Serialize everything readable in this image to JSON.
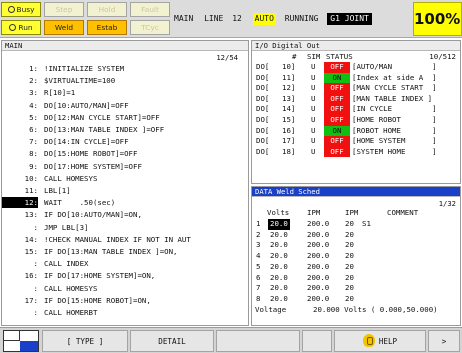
{
  "status_buttons": {
    "busy": "Busy",
    "step": "Step",
    "hold": "Hold",
    "fault": "Fault",
    "run": "Run",
    "weld": "Weld",
    "estab": "Estab",
    "tcyc": "TCyc"
  },
  "program_status": {
    "program": "MAIN",
    "line_label": "LINE",
    "line_number": "12",
    "mode": "AUTO",
    "state": "RUNNING",
    "group_joint": "G1  JOINT",
    "override": "100%"
  },
  "program_panel": {
    "title": "MAIN",
    "position": "12/54",
    "current_line": "12",
    "lines": [
      {
        "num": "1:",
        "text": "!INITIALIZE SYSTEM"
      },
      {
        "num": "2:",
        "text": "$VIRTUALTIME=100"
      },
      {
        "num": "3:",
        "text": "R[10]=1"
      },
      {
        "num": "4:",
        "text": "DO[10:AUTO/MAN]=OFF"
      },
      {
        "num": "5:",
        "text": "DO[12:MAN CYCLE START]=OFF"
      },
      {
        "num": "6:",
        "text": "DO[13:MAN TABLE INDEX ]=OFF"
      },
      {
        "num": "7:",
        "text": "DO[14:IN CYCLE]=OFF"
      },
      {
        "num": "8:",
        "text": "DO[15:HOME ROBOT]=OFF"
      },
      {
        "num": "9:",
        "text": "DO[17:HOME SYSTEM]=OFF"
      },
      {
        "num": "10:",
        "text": "CALL HOMESYS"
      },
      {
        "num": "11:",
        "text": "LBL[1]"
      },
      {
        "num": "12:",
        "text": "WAIT    .50(sec)"
      },
      {
        "num": "13:",
        "text": "IF DO[10:AUTO/MAN]=ON,"
      },
      {
        "num": ":",
        "text": "JMP LBL[3]"
      },
      {
        "num": "14:",
        "text": "!CHECK MANUAL INDEX IF NOT IN AUT"
      },
      {
        "num": "15:",
        "text": "IF DO[13:MAN TABLE INDEX ]=ON,"
      },
      {
        "num": ":",
        "text": "CALL INDEX"
      },
      {
        "num": "16:",
        "text": "IF DO[17:HOME SYSTEM]=ON,"
      },
      {
        "num": ":",
        "text": "CALL HOMESYS"
      },
      {
        "num": "17:",
        "text": "IF DO[15:HOME ROBOT]=ON,"
      },
      {
        "num": ":",
        "text": "CALL HOMERBT"
      }
    ]
  },
  "io_panel": {
    "title": "I/O Digital Out",
    "header_num": "#",
    "header_sim": "SIM",
    "header_status": "STATUS",
    "position": "10/512",
    "rows": [
      {
        "type": "DO[",
        "num": "10]",
        "sim": "U",
        "status": "OFF",
        "comment": "[AUTO/MAN         ]"
      },
      {
        "type": "DO[",
        "num": "11]",
        "sim": "U",
        "status": "ON",
        "comment": "[Index at side A  ]"
      },
      {
        "type": "DO[",
        "num": "12]",
        "sim": "U",
        "status": "OFF",
        "comment": "[MAN CYCLE START  ]"
      },
      {
        "type": "DO[",
        "num": "13]",
        "sim": "U",
        "status": "OFF",
        "comment": "[MAN TABLE INDEX ]"
      },
      {
        "type": "DO[",
        "num": "14]",
        "sim": "U",
        "status": "OFF",
        "comment": "[IN CYCLE         ]"
      },
      {
        "type": "DO[",
        "num": "15]",
        "sim": "U",
        "status": "OFF",
        "comment": "[HOME ROBOT       ]"
      },
      {
        "type": "DO[",
        "num": "16]",
        "sim": "U",
        "status": "ON",
        "comment": "[ROBOT HOME       ]"
      },
      {
        "type": "DO[",
        "num": "17]",
        "sim": "U",
        "status": "OFF",
        "comment": "[HOME SYSTEM      ]"
      },
      {
        "type": "DO[",
        "num": "18]",
        "sim": "U",
        "status": "OFF",
        "comment": "[SYSTEM HOME      ]"
      }
    ]
  },
  "weld_panel": {
    "title": "DATA Weld Sched",
    "position": "1/32",
    "headers": {
      "volts": "Volts",
      "ipm1": "IPM",
      "ipm2": "IPM",
      "comment": "COMMENT"
    },
    "rows": [
      {
        "idx": "1",
        "volts": "20.0",
        "ipm1": "200.0",
        "ipm2": "20",
        "comment": "S1"
      },
      {
        "idx": "2",
        "volts": "20.0",
        "ipm1": "200.0",
        "ipm2": "20",
        "comment": ""
      },
      {
        "idx": "3",
        "volts": "20.0",
        "ipm1": "200.0",
        "ipm2": "20",
        "comment": ""
      },
      {
        "idx": "4",
        "volts": "20.0",
        "ipm1": "200.0",
        "ipm2": "20",
        "comment": ""
      },
      {
        "idx": "5",
        "volts": "20.0",
        "ipm1": "200.0",
        "ipm2": "20",
        "comment": ""
      },
      {
        "idx": "6",
        "volts": "20.0",
        "ipm1": "200.0",
        "ipm2": "20",
        "comment": ""
      },
      {
        "idx": "7",
        "volts": "20.0",
        "ipm1": "200.0",
        "ipm2": "20",
        "comment": ""
      },
      {
        "idx": "8",
        "volts": "20.0",
        "ipm1": "200.0",
        "ipm2": "20",
        "comment": ""
      }
    ],
    "footer_label": "Voltage",
    "footer_value": "20.000 Volts ( 0.000,50.000)"
  },
  "function_keys": {
    "f1": "[ TYPE ]",
    "f2": "DETAIL",
    "f5": "HELP",
    "next": ">"
  },
  "colors": {
    "status_off": "#f01010",
    "status_on": "#10c010",
    "active_yellow": "#ffff33",
    "title_blue": "#1a3fc8"
  },
  "icons": {
    "busy": "circle-indicator-icon",
    "run": "circle-indicator-icon",
    "help": "help-bulb-icon",
    "screen_split": "window-split-icon"
  }
}
